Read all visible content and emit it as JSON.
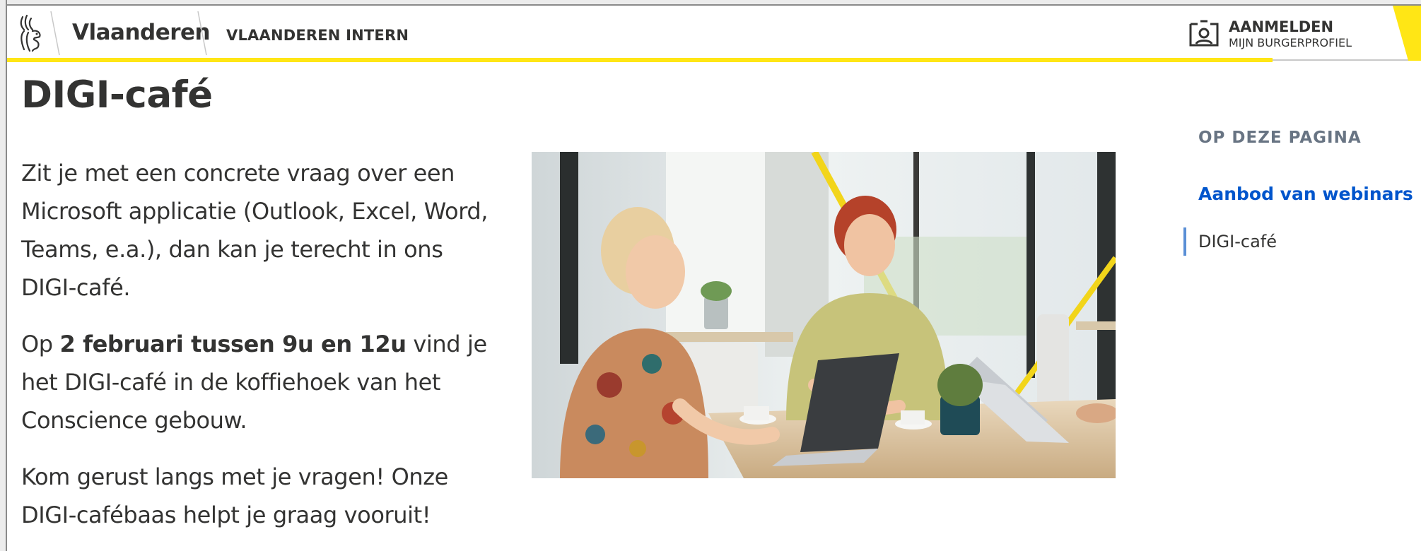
{
  "header": {
    "brand": "Vlaanderen",
    "section": "VLAANDEREN INTERN",
    "login_title": "AANMELDEN",
    "login_sub": "MIJN BURGERPROFIEL",
    "accent_color": "#ffe615"
  },
  "main": {
    "title": "DIGI-café",
    "paragraph1": "Zit je met een concrete vraag over een Microsoft applicatie (Outlook, Excel, Word, Teams, e.a.), dan kan je terecht in ons DIGI-café.",
    "paragraph2_prefix": "Op ",
    "paragraph2_bold": "2 februari tussen 9u en 12u",
    "paragraph2_suffix": " vind je het DIGI-café in de koffiehoek van het Conscience gebouw.",
    "paragraph3": "Kom gerust langs met je vragen! Onze DIGI-cafébaas helpt je graag vooruit!"
  },
  "toc": {
    "title": "OP DEZE PAGINA",
    "items": [
      {
        "label": "Aanbod van webinars",
        "active": false
      },
      {
        "label": "DIGI-café",
        "active": true
      }
    ]
  },
  "icons": {
    "logo": "flemish-lion-icon",
    "login": "profile-card-icon"
  }
}
